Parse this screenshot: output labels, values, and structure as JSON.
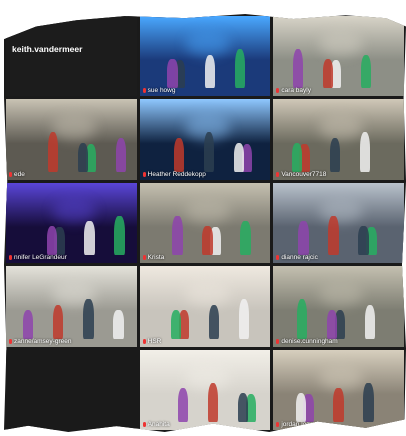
{
  "tiles": [
    {
      "name": "keith.vandermeer",
      "kind": "host",
      "bg": "#1c1c1c"
    },
    {
      "name": "sue howg",
      "bg": "#1b3a7a",
      "accent": "#4aa8ff"
    },
    {
      "name": "cara bayly",
      "bg": "#8d8f86",
      "accent": "#d8d4c8"
    },
    {
      "name": "ede",
      "bg": "#5d5a52",
      "accent": "#c9c3b4"
    },
    {
      "name": "Heather Reddekopp",
      "bg": "#0f2240",
      "accent": "#8fc8ff"
    },
    {
      "name": "Vancouver7718",
      "bg": "#6b6a5e",
      "accent": "#d0c8b8"
    },
    {
      "name": "nnifer LeGrandeur",
      "bg": "#160d3a",
      "accent": "#5a46d8"
    },
    {
      "name": "Krista",
      "bg": "#7c7a70",
      "accent": "#c5c0b0"
    },
    {
      "name": "dianne rajcic",
      "bg": "#5a6370",
      "accent": "#b9c2cc"
    },
    {
      "name": "zanne/amsey-green",
      "bg": "#9b9a92",
      "accent": "#e4e2da"
    },
    {
      "name": "HSR",
      "bg": "#c8c4bc",
      "accent": "#efe9e0"
    },
    {
      "name": "denise.cunningham",
      "bg": "#7d7d72",
      "accent": "#c4c0b0"
    },
    {
      "name": "",
      "kind": "empty",
      "bg": "#1a1a1a"
    },
    {
      "name": "Anahita",
      "bg": "#d6d3cc",
      "accent": "#f2efe8"
    },
    {
      "name": "jordan.logan",
      "bg": "#8a8376",
      "accent": "#d7cfbe"
    }
  ]
}
